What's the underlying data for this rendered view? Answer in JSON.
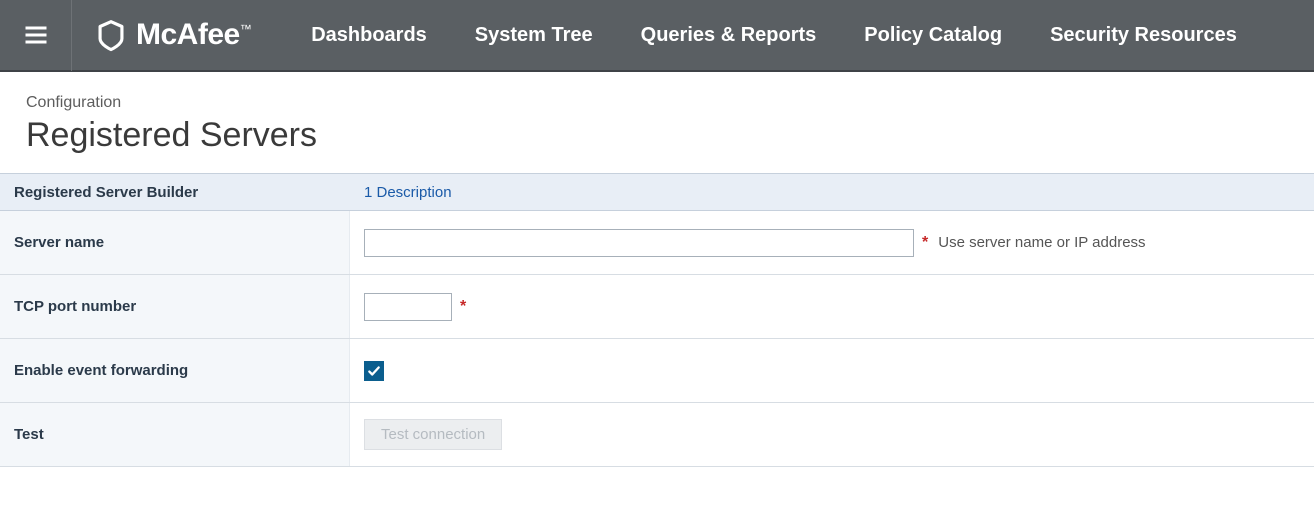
{
  "brand": {
    "name": "McAfee",
    "tm": "™"
  },
  "nav": {
    "items": [
      "Dashboards",
      "System Tree",
      "Queries & Reports",
      "Policy Catalog",
      "Security Resources"
    ]
  },
  "header": {
    "breadcrumb": "Configuration",
    "title": "Registered Servers"
  },
  "builder": {
    "title": "Registered Server Builder",
    "step": "1 Description"
  },
  "form": {
    "server_name": {
      "label": "Server name",
      "value": "",
      "required_mark": "*",
      "hint": "Use server name or IP address"
    },
    "tcp_port": {
      "label": "TCP port number",
      "value": "",
      "required_mark": "*"
    },
    "enable_forwarding": {
      "label": "Enable event forwarding",
      "checked": true
    },
    "test": {
      "label": "Test",
      "button": "Test connection"
    }
  }
}
